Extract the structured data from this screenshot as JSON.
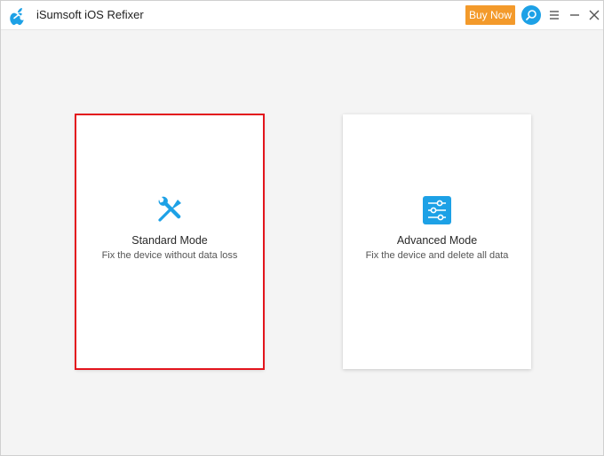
{
  "app": {
    "title": "iSumsoft iOS Refixer",
    "logo_icon": "apple-logo-with-wrench-icon"
  },
  "titlebar": {
    "buy_label": "Buy Now",
    "search_icon": "search-icon",
    "menu_icon": "hamburger-menu-icon",
    "minimize_icon": "minimize-icon",
    "close_icon": "close-icon"
  },
  "modes": [
    {
      "title": "Standard Mode",
      "subtitle": "Fix the device without data loss",
      "icon": "wrench-screwdriver-icon",
      "selected": true
    },
    {
      "title": "Advanced Mode",
      "subtitle": "Fix the device and delete all data",
      "icon": "sliders-icon",
      "selected": false
    }
  ],
  "colors": {
    "accent_blue": "#1da1e6",
    "buy_orange": "#f39a2b",
    "selected_border": "#e3151d"
  }
}
